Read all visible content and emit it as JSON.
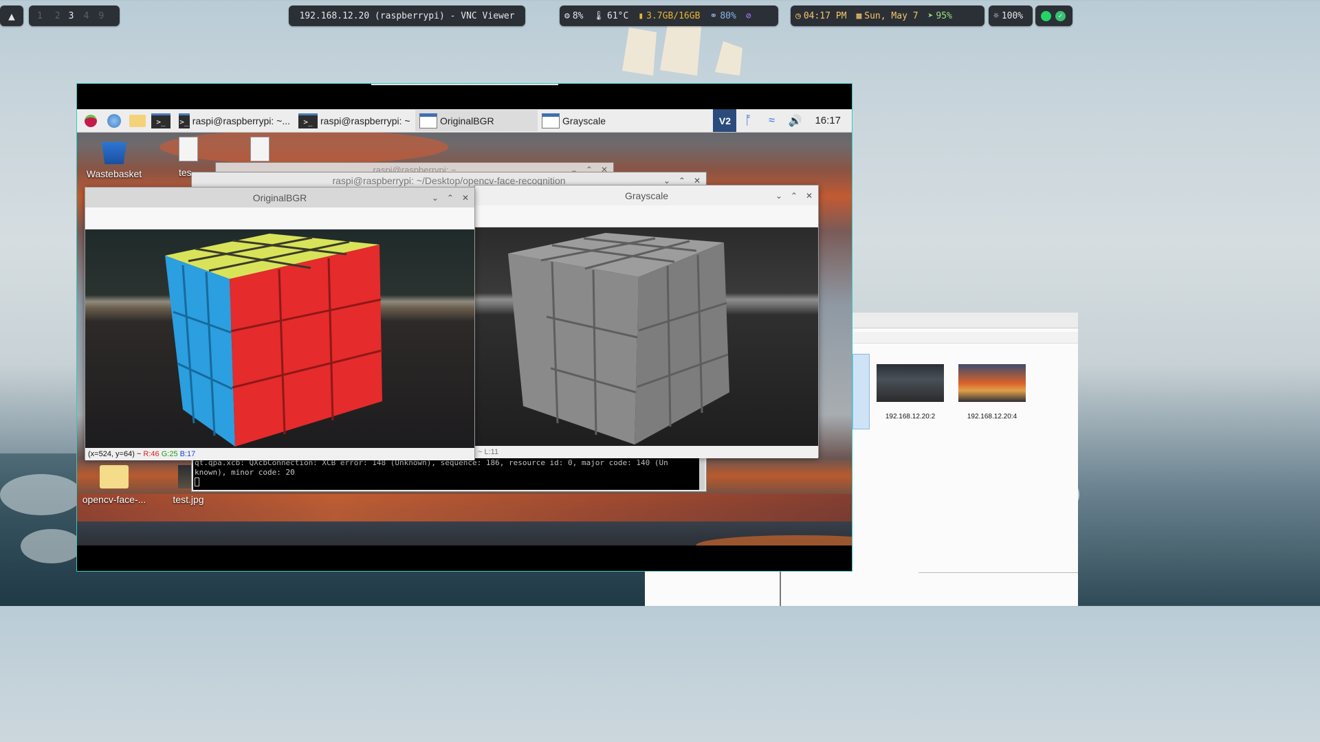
{
  "topbar": {
    "launcher_icon": "arch-logo-icon",
    "workspaces": [
      "1",
      "2",
      "3",
      "4",
      "9"
    ],
    "active_workspace": "3",
    "window_title": "192.168.12.20 (raspberrypi) - VNC Viewer",
    "cpu": "8%",
    "temp": "61°C",
    "memory": "3.7GB/16GB",
    "headphones": "80%",
    "time": "04:17 PM",
    "date": "Sun, May  7",
    "battery": "95%",
    "brightness": "100%"
  },
  "pi_taskbar": {
    "tasks": [
      {
        "label": "raspi@raspberrypi: ~..."
      },
      {
        "label": "raspi@raspberrypi: ~"
      },
      {
        "label": "OriginalBGR"
      },
      {
        "label": "Grayscale"
      }
    ],
    "clock": "16:17",
    "tray_icons": [
      "vnc-icon",
      "bluetooth-icon",
      "wifi-icon",
      "volume-icon"
    ]
  },
  "desktop": {
    "icons": [
      {
        "label": "Wastebasket"
      },
      {
        "label": "tes"
      },
      {
        "label": "opencv-face-..."
      },
      {
        "label": "test.jpg"
      }
    ]
  },
  "terminal_back": {
    "title": "raspi@raspberrypi: ~"
  },
  "terminal": {
    "title": "raspi@raspberrypi: ~/Desktop/opencv-face-recognition",
    "line1": "qt.qpa.xcb: QXcbConnection: XCB error: 148 (Unknown), sequence: 186, resource id: 0, major code: 140 (Un",
    "line2": "known), minor code: 20"
  },
  "original_window": {
    "title": "OriginalBGR",
    "status_coords": "(x=524, y=64) ~",
    "status_r": "R:46",
    "status_g": "G:25",
    "status_b": "B:17"
  },
  "gray_window": {
    "title": "Grayscale",
    "status": "~ L:11"
  },
  "file_manager": {
    "thumbs": [
      {
        "label": "192.168.12.20:2"
      },
      {
        "label": "192.168.12.20:4"
      }
    ]
  },
  "colors": {
    "accent": "#35c9c0",
    "status_r": "#e02020",
    "status_g": "#1a9a1a",
    "status_b": "#1f3fe0",
    "memory": "#e8b630"
  }
}
